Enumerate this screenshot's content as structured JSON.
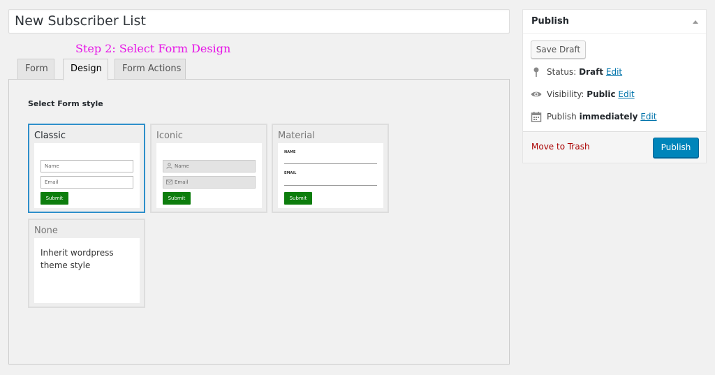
{
  "title_field": {
    "value": "New Subscriber List"
  },
  "step_label": "Step 2: Select Form Design",
  "tabs": [
    {
      "label": "Form",
      "active": false
    },
    {
      "label": "Design",
      "active": true
    },
    {
      "label": "Form Actions",
      "active": false
    }
  ],
  "design": {
    "section_label": "Select Form style",
    "styles": [
      {
        "name": "Classic",
        "selected": true,
        "fields": [
          "Name",
          "Email"
        ],
        "submit": "Submit"
      },
      {
        "name": "Iconic",
        "selected": false,
        "fields": [
          "Name",
          "Email"
        ],
        "submit": "Submit"
      },
      {
        "name": "Material",
        "selected": false,
        "fields": [
          "NAME",
          "EMAIL"
        ],
        "submit": "Submit"
      },
      {
        "name": "None",
        "selected": false,
        "description": "Inherit wordpress theme style"
      }
    ]
  },
  "publish_box": {
    "title": "Publish",
    "save_draft": "Save Draft",
    "status_label": "Status:",
    "status_value": "Draft",
    "visibility_label": "Visibility:",
    "visibility_value": "Public",
    "publish_label": "Publish",
    "publish_value": "immediately",
    "edit": "Edit",
    "move_to_trash": "Move to Trash",
    "publish_button": "Publish"
  },
  "colors": {
    "accent": "#0085ba",
    "selected_border": "#2e8fca",
    "submit_green": "#0d7d0d",
    "step_label": "#e614e6",
    "trash": "#aa0000"
  },
  "icons": {
    "status": "pin-icon",
    "visibility": "eye-icon",
    "schedule": "calendar-icon",
    "collapse": "caret-up-icon",
    "name_field": "user-icon",
    "email_field": "envelope-icon"
  }
}
